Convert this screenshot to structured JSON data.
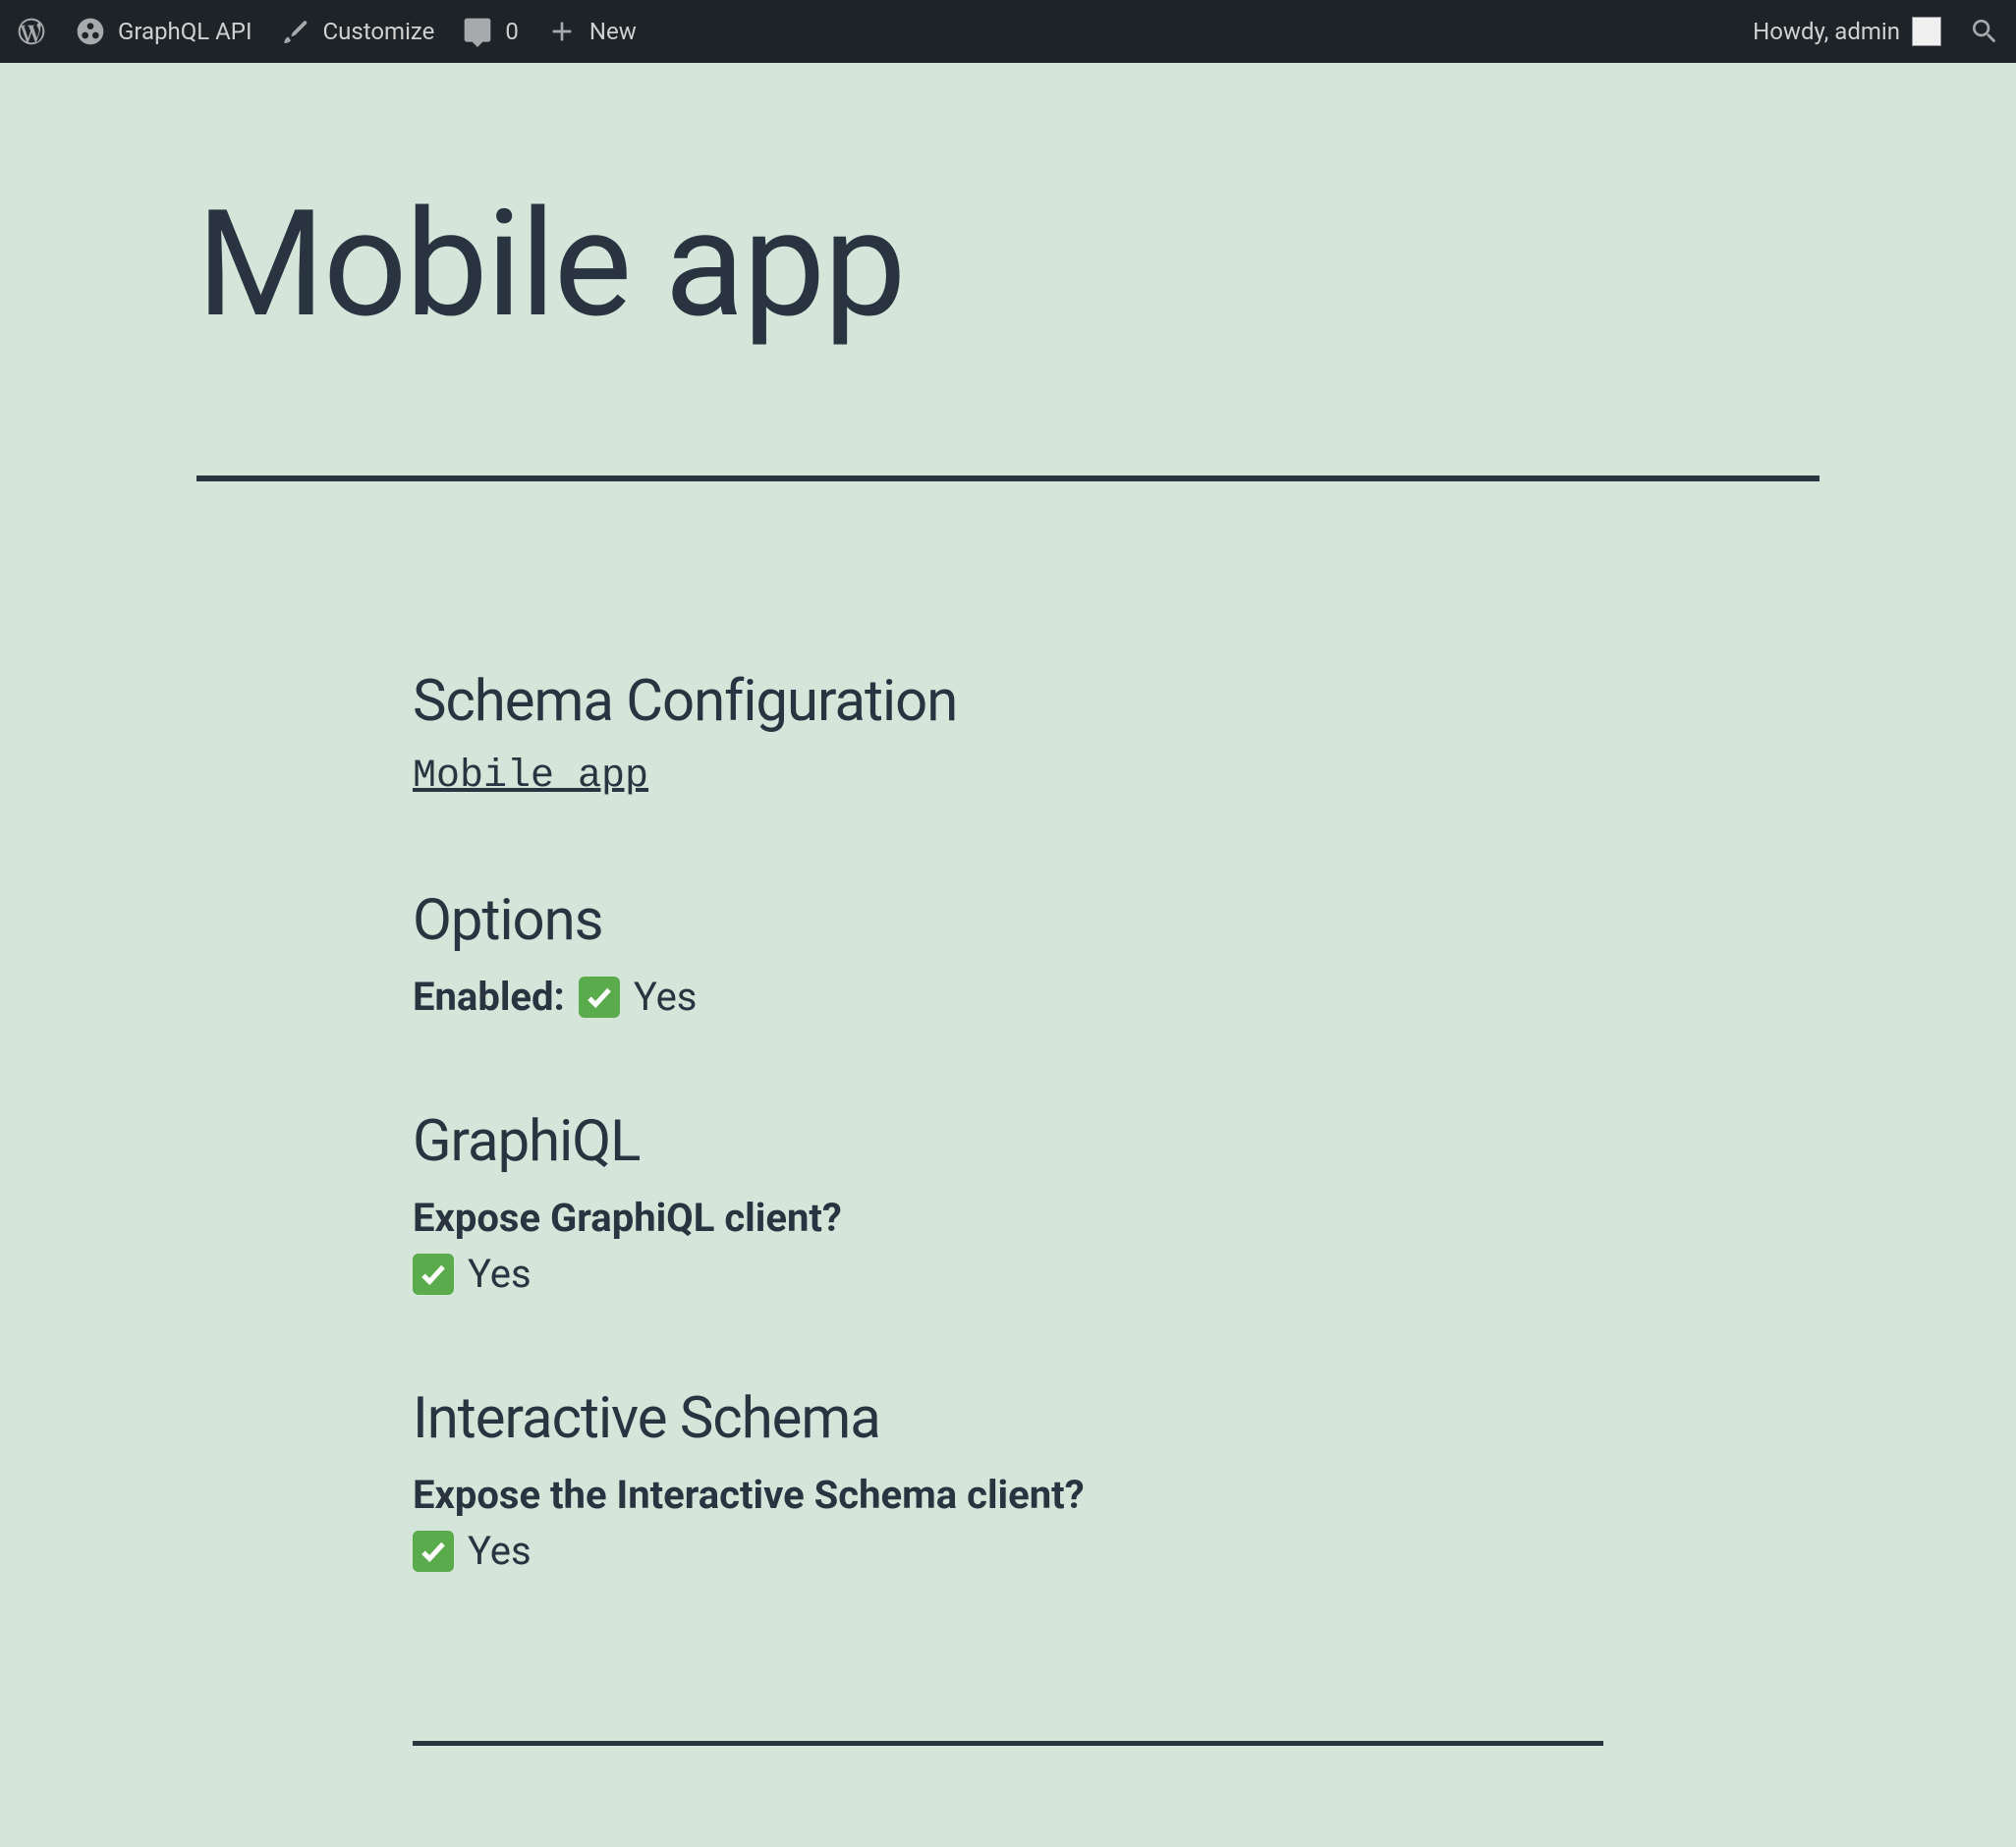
{
  "admin_bar": {
    "site_title": "GraphQL API",
    "customize_label": "Customize",
    "comments_count": "0",
    "new_label": "New",
    "greeting": "Howdy, admin"
  },
  "page": {
    "title": "Mobile app"
  },
  "sections": {
    "schema_config": {
      "heading": "Schema Configuration",
      "link_text": "Mobile app"
    },
    "options": {
      "heading": "Options",
      "enabled_label": "Enabled:",
      "enabled_value": "Yes"
    },
    "graphiql": {
      "heading": "GraphiQL",
      "question": "Expose GraphiQL client?",
      "value": "Yes"
    },
    "interactive_schema": {
      "heading": "Interactive Schema",
      "question": "Expose the Interactive Schema client?",
      "value": "Yes"
    }
  }
}
